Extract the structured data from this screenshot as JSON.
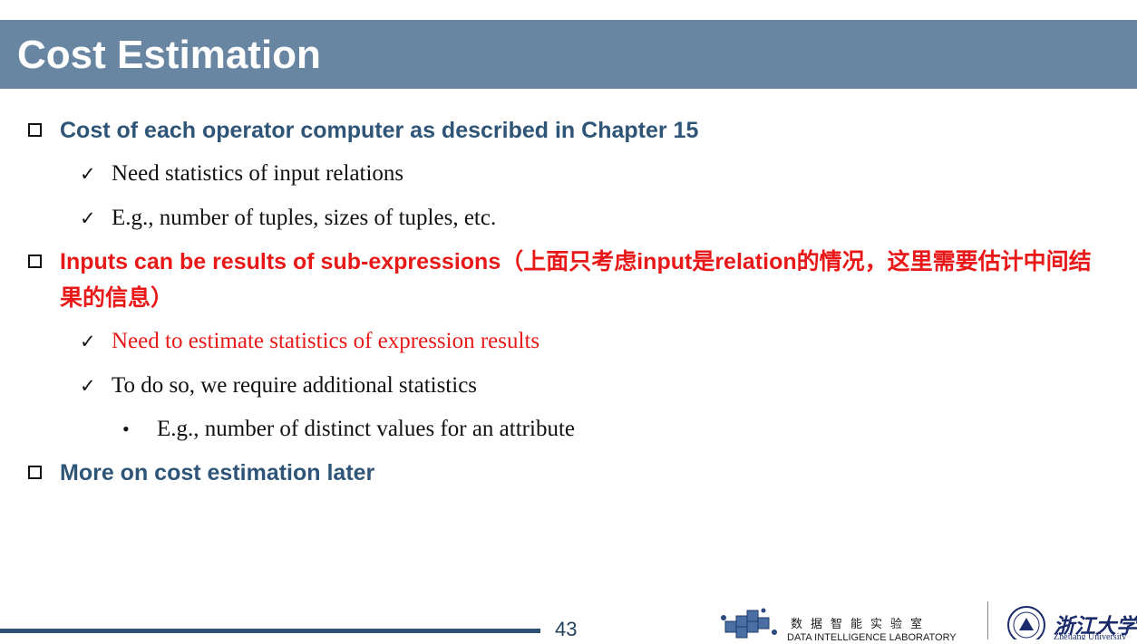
{
  "slide": {
    "title": "Cost Estimation",
    "page_number": "43"
  },
  "bullets": [
    {
      "text": "Cost of each operator computer as described in Chapter 15",
      "color": "#2e5577",
      "sub": [
        {
          "text": "Need statistics of input relations"
        },
        {
          "text": "E.g., number of tuples, sizes of tuples, etc."
        }
      ]
    },
    {
      "text": "Inputs can be results of sub-expressions（上面只考虑input是relation的情况，这里需要估计中间结果的信息）",
      "color": "#e81818",
      "sub": [
        {
          "text": "Need to estimate statistics of expression results",
          "color": "#e81818"
        },
        {
          "text": "To do so, we require additional statistics",
          "sub": [
            {
              "text": "E.g., number of distinct values for an attribute"
            }
          ]
        }
      ]
    },
    {
      "text": "More on cost estimation later",
      "color": "#2e5577"
    }
  ],
  "footer": {
    "lab_name_cn": "数据智能实验室",
    "lab_name_en": "DATA INTELLIGENCE LABORATORY",
    "university_cn": "浙江大学",
    "university_en": "Zhejiang University"
  },
  "icons": {
    "square_bullet": "square-bullet-icon",
    "check_bullet": "checkmark-icon",
    "dot_bullet": "dot-bullet-icon",
    "lab_logo": "cubes-logo",
    "university_logo": "zju-seal-logo"
  },
  "theme": {
    "title_bar": "#6886a2",
    "heading_blue": "#2e5577",
    "emphasis_red": "#e81818",
    "footer_line": "#2d5172"
  }
}
